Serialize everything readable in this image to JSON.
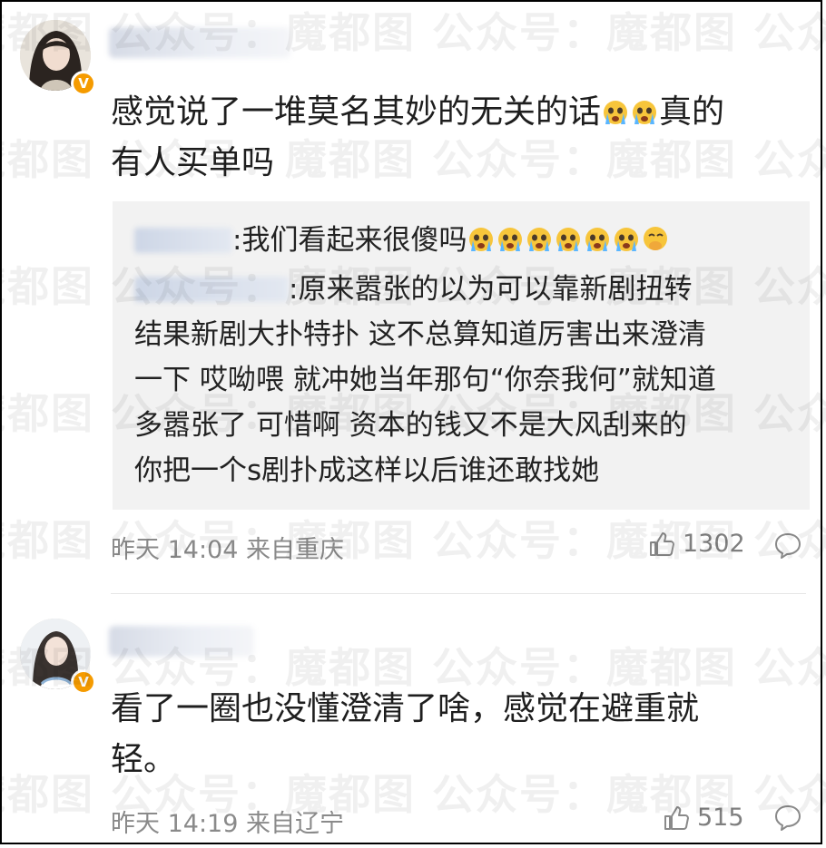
{
  "watermark_text": "魔都图  公众号：魔都图  公众号：魔都图  公众号：魔都图",
  "comments": [
    {
      "avatar": "avatar-woman-dark-hair",
      "verified_badge": "V",
      "text_line1": "感觉说了一堆莫名其妙的无关的话",
      "text_line1_emojis": [
        "crying-emoji",
        "crying-emoji"
      ],
      "text_line1_tail": "真的",
      "text_line2": "有人买单吗",
      "replies": [
        {
          "text": ":我们看起来很傻吗",
          "emojis": [
            "crying-emoji",
            "crying-emoji",
            "crying-emoji",
            "crying-emoji",
            "crying-emoji",
            "crying-emoji",
            "thinking-emoji"
          ]
        },
        {
          "lines": [
            ":原来嚣张的以为可以靠新剧扭转",
            "结果新剧大扑特扑 这不总算知道厉害出来澄清",
            "一下 哎呦喂 就冲她当年那句“你奈我何”就知道",
            "多嚣张了 可惜啊 资本的钱又不是大风刮来的",
            "你把一个s剧扑成这样以后谁还敢找她"
          ]
        }
      ],
      "time": "昨天 14:04 来自重庆",
      "likes": "1302"
    },
    {
      "avatar": "avatar-girl-white-dress",
      "verified_badge": "V",
      "text_line1": "看了一圈也没懂澄清了啥，感觉在避重就",
      "text_line2": "轻。",
      "time": "昨天 14:19 来自辽宁",
      "likes": "515"
    }
  ],
  "colors": {
    "badge": "#f59b00",
    "meta": "#8a8a8a",
    "reply_bg": "#f2f2f2"
  }
}
